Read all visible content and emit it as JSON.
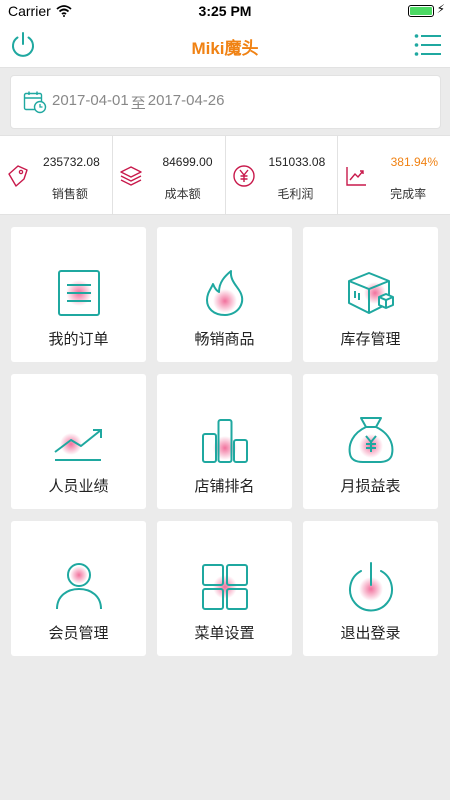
{
  "status_bar": {
    "carrier": "Carrier",
    "time": "3:25 PM"
  },
  "navbar": {
    "title": "Miki魔头",
    "left_icon": "power-icon",
    "right_icon": "list-menu-icon"
  },
  "date_range": {
    "start": "2017-04-01",
    "separator": "至",
    "end": "2017-04-26"
  },
  "stats": [
    {
      "value": "235732.08",
      "label": "销售额",
      "icon": "price-tag-icon"
    },
    {
      "value": "84699.00",
      "label": "成本额",
      "icon": "layers-icon"
    },
    {
      "value": "151033.08",
      "label": "毛利润",
      "icon": "yen-coin-icon"
    },
    {
      "value": "381.94%",
      "label": "完成率",
      "icon": "trend-chart-icon"
    }
  ],
  "menu": [
    {
      "label": "我的订单",
      "icon": "order-list-icon"
    },
    {
      "label": "畅销商品",
      "icon": "flame-icon"
    },
    {
      "label": "库存管理",
      "icon": "boxes-icon"
    },
    {
      "label": "人员业绩",
      "icon": "trend-arrow-icon"
    },
    {
      "label": "店铺排名",
      "icon": "bar-ranking-icon"
    },
    {
      "label": "月损益表",
      "icon": "money-bag-icon"
    },
    {
      "label": "会员管理",
      "icon": "member-user-icon"
    },
    {
      "label": "菜单设置",
      "icon": "grid-menu-icon"
    },
    {
      "label": "退出登录",
      "icon": "logout-power-icon"
    }
  ],
  "colors": {
    "accent": "#f08214",
    "teal": "#1fa8a0",
    "magenta": "#c8194b",
    "background": "#ebebeb"
  }
}
